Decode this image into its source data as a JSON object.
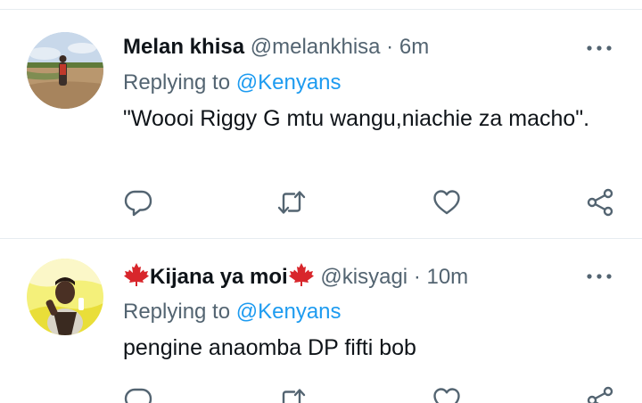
{
  "tweets": [
    {
      "display_name": "Melan khisa",
      "handle": "@melankhisa",
      "separator": "·",
      "time": "6m",
      "reply_prefix": "Replying to",
      "reply_to": "@Kenyans",
      "text": "\"Woooi Riggy G mtu wangu,niachie za macho\".",
      "icons": {
        "more": "more-horizontal-icon",
        "reply": "reply-icon",
        "retweet": "retweet-icon",
        "like": "heart-icon",
        "share": "share-icon"
      }
    },
    {
      "display_name": "Kijana ya moi",
      "name_emoji": "maple-leaf-icon",
      "handle": "@kisyagi",
      "separator": "·",
      "time": "10m",
      "reply_prefix": "Replying to",
      "reply_to": "@Kenyans",
      "text": "pengine anaomba DP fifti bob",
      "icons": {
        "more": "more-horizontal-icon",
        "reply": "reply-icon",
        "retweet": "retweet-icon",
        "like": "heart-icon",
        "share": "share-icon"
      }
    }
  ],
  "colors": {
    "text": "#0f1419",
    "secondary": "#536471",
    "link": "#1d9bf0",
    "separator": "#e6ecf0",
    "maple_leaf": "#d8262b"
  }
}
